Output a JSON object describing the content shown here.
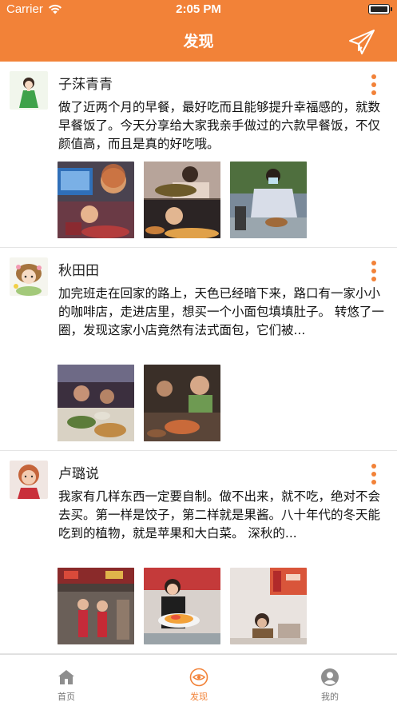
{
  "status_bar": {
    "carrier": "Carrier",
    "time": "2:05 PM"
  },
  "header": {
    "title": "发现",
    "accent_color": "#f28238"
  },
  "posts": [
    {
      "username": "子莯青青",
      "text": "做了近两个月的早餐，最好吃而且能够提升幸福感的，就数早餐饭了。今天分享给大家我亲手做过的六款早餐饭，不仅颜值高，而且是真的好吃哦。",
      "image_count": 3
    },
    {
      "username": "秋田田",
      "text": "加完班走在回家的路上，天色已经暗下来，路口有一家小小的咖啡店，走进店里，想买一个小面包填填肚子。 转悠了一圈，发现这家小店竟然有法式面包，它们被...",
      "image_count": 2
    },
    {
      "username": "卢璐说",
      "text": "我家有几样东西一定要自制。做不出来，就不吃，绝对不会去买。第一样是饺子，第二样就是果酱。八十年代的冬天能吃到的植物，就是苹果和大白菜。 深秋的...",
      "image_count": 3
    }
  ],
  "tabbar": {
    "items": [
      {
        "label": "首页",
        "icon": "home-icon",
        "active": false
      },
      {
        "label": "发现",
        "icon": "eye-icon",
        "active": true
      },
      {
        "label": "我的",
        "icon": "profile-icon",
        "active": false
      }
    ]
  }
}
